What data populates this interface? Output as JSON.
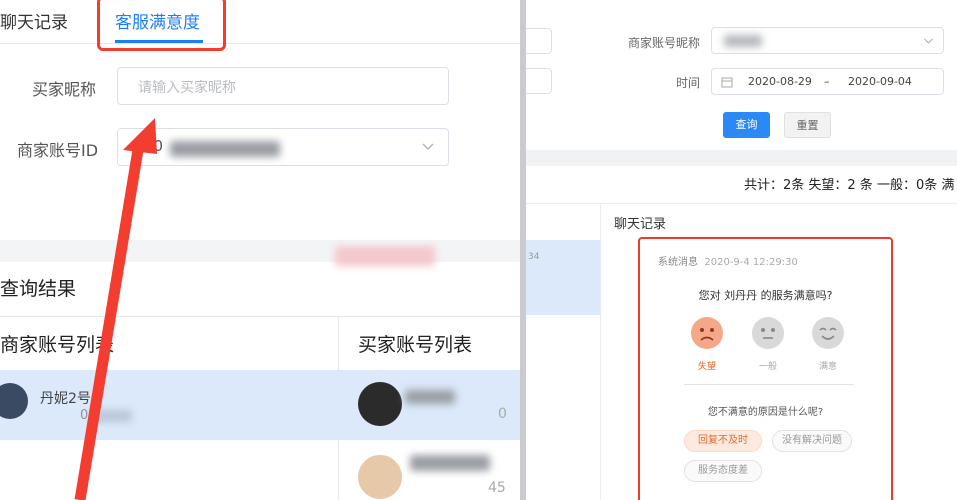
{
  "left_panel": {
    "tabs": [
      "聊天记录",
      "客服满意度"
    ],
    "buyer_nick_label": "买家昵称",
    "buyer_nick_placeholder": "请输入买家昵称",
    "merchant_id_label": "商家账号ID",
    "merchant_id_value": "00",
    "results_title": "查询结果",
    "merchant_list_header": "商家账号列表",
    "buyer_list_header": "买家账号列表",
    "merchant_name": "丹妮2号",
    "merchant_sub": "00",
    "buyer_row1_tail": "0",
    "buyer_row2_tail": "45"
  },
  "right_panel": {
    "merchant_nick_label": "商家账号昵称",
    "time_label": "时间",
    "date_start": "2020-08-29",
    "date_sep": "–",
    "date_end": "2020-09-04",
    "query_button": "查询",
    "reset_button": "重置",
    "stats": "共计：2条 失望：2 条 一般：0条 满",
    "left_col_fragment": "34",
    "chat_title": "聊天记录",
    "card": {
      "sys_msg": "系统消息",
      "timestamp": "2020-9-4 12:29:30",
      "question": "您对 刘丹丹 的服务满意吗?",
      "faces": [
        {
          "label": "失望",
          "selected": true,
          "color": "#f39b6d"
        },
        {
          "label": "一般",
          "selected": false,
          "color": "#d7d7d7"
        },
        {
          "label": "满意",
          "selected": false,
          "color": "#d7d7d7"
        }
      ],
      "reason_question": "您不满意的原因是什么呢?",
      "reasons": [
        {
          "label": "回复不及时",
          "selected": true
        },
        {
          "label": "没有解决问题",
          "selected": false
        },
        {
          "label": "服务态度差",
          "selected": false
        }
      ]
    }
  },
  "colors": {
    "accent": "#1f7ef4",
    "highlight_box": "#f23d30",
    "selected_row": "#dbe9fb"
  }
}
